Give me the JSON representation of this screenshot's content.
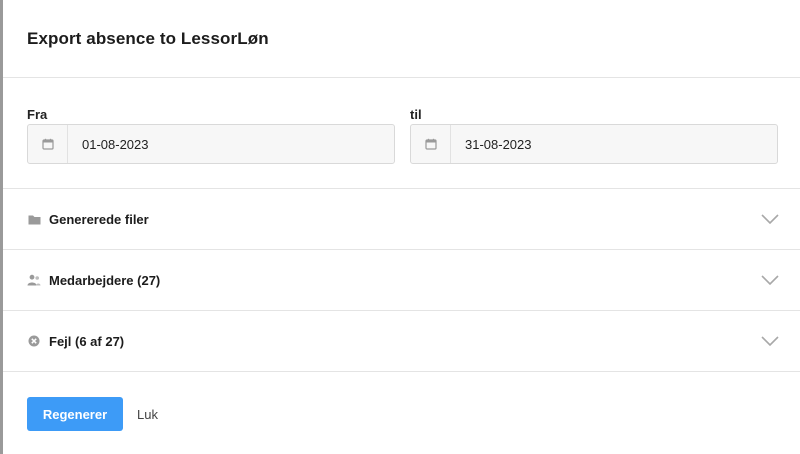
{
  "dialog": {
    "title": "Export absence to LessorLøn"
  },
  "dates": {
    "from_label": "Fra",
    "from_value": "01-08-2023",
    "from_icon": "calendar-icon",
    "to_label": "til",
    "to_value": "31-08-2023",
    "to_icon": "calendar-icon"
  },
  "sections": [
    {
      "label": "Genererede filer",
      "icon": "folder-icon"
    },
    {
      "label": "Medarbejdere (27)",
      "icon": "users-icon"
    },
    {
      "label": "Fejl (6 af 27)",
      "icon": "error-circle-icon"
    }
  ],
  "footer": {
    "primary_label": "Regenerer",
    "secondary_label": "Luk"
  },
  "colors": {
    "primary": "#3d9bf7",
    "icon_gray": "#9a9a9a",
    "border": "#e4e4e4"
  }
}
